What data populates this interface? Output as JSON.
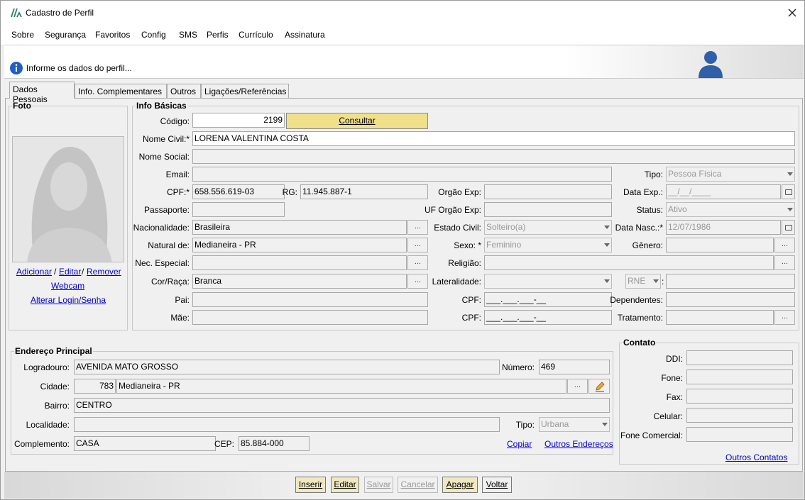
{
  "window": {
    "title": "Cadastro de Perfil"
  },
  "menu": [
    {
      "label": "Sobre"
    },
    {
      "label": "Segurança"
    },
    {
      "label": "Favoritos"
    },
    {
      "label": "Config"
    },
    {
      "label": "SMS"
    },
    {
      "label": "Perfis"
    },
    {
      "label": "Currículo"
    },
    {
      "label": "Assinatura"
    }
  ],
  "info": {
    "message": "Informe os dados do perfil..."
  },
  "tabs": [
    {
      "label": "Dados Pessoais",
      "active": true
    },
    {
      "label": "Info. Complementares"
    },
    {
      "label": "Outros"
    },
    {
      "label": "Ligações/Referências"
    }
  ],
  "foto": {
    "title": "Foto",
    "add": "Adicionar",
    "sep": "/",
    "edit": "Editar",
    "remove": "Remover",
    "webcam": "Webcam",
    "alter_login": "Alterar Login/Senha"
  },
  "basic": {
    "title": "Info Básicas",
    "codigo_label": "Código:",
    "codigo": "2199",
    "consultar": "Consultar",
    "nome_civil_label": "Nome Civil:*",
    "nome_civil": "LORENA VALENTINA COSTA",
    "nome_social_label": "Nome Social:",
    "nome_social": "",
    "email_label": "Email:",
    "email": "",
    "tipo_label": "Tipo:",
    "tipo": "Pessoa Física",
    "cpf_label": "CPF:*",
    "cpf": "658.556.619-03",
    "rg_label": "RG:",
    "rg": "11.945.887-1",
    "orgao_label": "Orgão Exp:",
    "orgao": "",
    "data_exp_label": "Data Exp.:",
    "data_exp": "__/__/____",
    "passaporte_label": "Passaporte:",
    "passaporte": "",
    "uf_orgao_label": "UF Orgão Exp:",
    "uf_orgao": "",
    "status_label": "Status:",
    "status": "Ativo",
    "nacionalidade_label": "Nacionalidade:",
    "nacionalidade": "Brasileira",
    "estado_civil_label": "Estado Civil:",
    "estado_civil": "Solteiro(a)",
    "data_nasc_label": "Data Nasc.:*",
    "data_nasc": "12/07/1986",
    "natural_label": "Natural de:",
    "natural": "Medianeira - PR",
    "sexo_label": "Sexo: *",
    "sexo": "Feminino",
    "genero_label": "Gênero:",
    "genero": "",
    "nec_label": "Nec. Especial:",
    "nec": "",
    "religiao_label": "Religião:",
    "religiao": "",
    "cor_label": "Cor/Raça:",
    "cor": "Branca",
    "lateralidade_label": "Lateralidade:",
    "lateralidade": "",
    "rne": "RNE",
    "colon": ":",
    "pai_label": "Pai:",
    "pai": "",
    "pai_cpf_label": "CPF:",
    "pai_cpf": "___.___.___-__",
    "dependentes_label": "Dependentes:",
    "dependentes": "",
    "mae_label": "Mãe:",
    "mae": "",
    "mae_cpf_label": "CPF:",
    "mae_cpf": "___.___.___-__",
    "tratamento_label": "Tratamento:",
    "tratamento": "",
    "dots": "..."
  },
  "endereco": {
    "title": "Endereço Principal",
    "logradouro_label": "Logradouro:",
    "logradouro": "AVENIDA MATO GROSSO",
    "numero_label": "Número:",
    "numero": "469",
    "cidade_label": "Cidade:",
    "cidade_cod": "783",
    "cidade": "Medianeira - PR",
    "bairro_label": "Bairro:",
    "bairro": "CENTRO",
    "localidade_label": "Localidade:",
    "localidade": "",
    "tipo_label": "Tipo:",
    "tipo": "Urbana",
    "complemento_label": "Complemento:",
    "complemento": "CASA",
    "cep_label": "CEP:",
    "cep": "85.884-000",
    "copiar": "Copiar",
    "outros": "Outros Endereços"
  },
  "contato": {
    "title": "Contato",
    "ddi_label": "DDI:",
    "fone_label": "Fone:",
    "fax_label": "Fax:",
    "celular_label": "Celular:",
    "fone_com_label": "Fone Comercial:",
    "outros": "Outros Contatos"
  },
  "buttons": {
    "inserir": "Inserir",
    "editar": "Editar",
    "salvar": "Salvar",
    "cancelar": "Cancelar",
    "apagar": "Apagar",
    "voltar": "Voltar"
  },
  "colors": {
    "accent": "#f0e08a",
    "link": "#0000cc"
  }
}
